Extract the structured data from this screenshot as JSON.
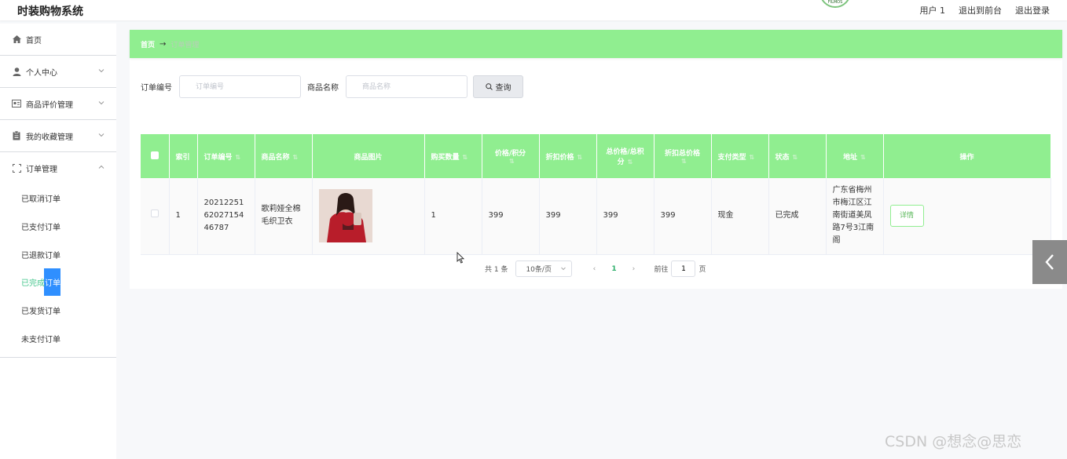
{
  "header": {
    "brand": "时装购物系统",
    "user": "用户 1",
    "to_front": "退出到前台",
    "logout": "退出登录"
  },
  "sidebar": {
    "items": [
      {
        "label": "首页",
        "icon": "home-icon"
      },
      {
        "label": "个人中心",
        "icon": "user-icon"
      },
      {
        "label": "商品评价管理",
        "icon": "card-icon"
      },
      {
        "label": "我的收藏管理",
        "icon": "clipboard-icon"
      },
      {
        "label": "订单管理",
        "icon": "frame-icon"
      }
    ],
    "sub_items": [
      {
        "label": "已取消订单"
      },
      {
        "label": "已支付订单"
      },
      {
        "label": "已退款订单"
      },
      {
        "label_head": "已完成",
        "label_tail": "订单"
      },
      {
        "label": "已发货订单"
      },
      {
        "label": "未支付订单"
      }
    ]
  },
  "breadcrumb": {
    "home": "首页",
    "arrow": "→",
    "current": "订单管理"
  },
  "search": {
    "order_no_label": "订单编号",
    "order_no_placeholder": "订单编号",
    "product_label": "商品名称",
    "product_placeholder": "商品名称",
    "query_label": "查询"
  },
  "table": {
    "headers": [
      "索引",
      "订单编号",
      "商品名称",
      "商品图片",
      "购买数量",
      "价格/积分",
      "折扣价格",
      "总价格/总积分",
      "折扣总价格",
      "支付类型",
      "状态",
      "地址",
      "操作"
    ],
    "rows": [
      {
        "index": "1",
        "order_no": "202122516202715446787",
        "product": "歌莉娅全棉毛织卫衣",
        "quantity": "1",
        "price": "399",
        "discount_price": "399",
        "total": "399",
        "discount_total": "399",
        "pay_type": "现金",
        "status": "已完成",
        "address": "广东省梅州市梅江区江南街道美凤路7号3江南阁",
        "action": "详情"
      }
    ]
  },
  "pager": {
    "total": "共 1 条",
    "page_size": "10条/页",
    "current": "1",
    "goto_label": "前往",
    "goto_value": "1",
    "page_unit": "页"
  },
  "watermark": "CSDN @想念@思恋",
  "colors": {
    "accent_green": "#90ee90",
    "active_text": "#43c58b",
    "active_marker": "#2f8fff"
  }
}
